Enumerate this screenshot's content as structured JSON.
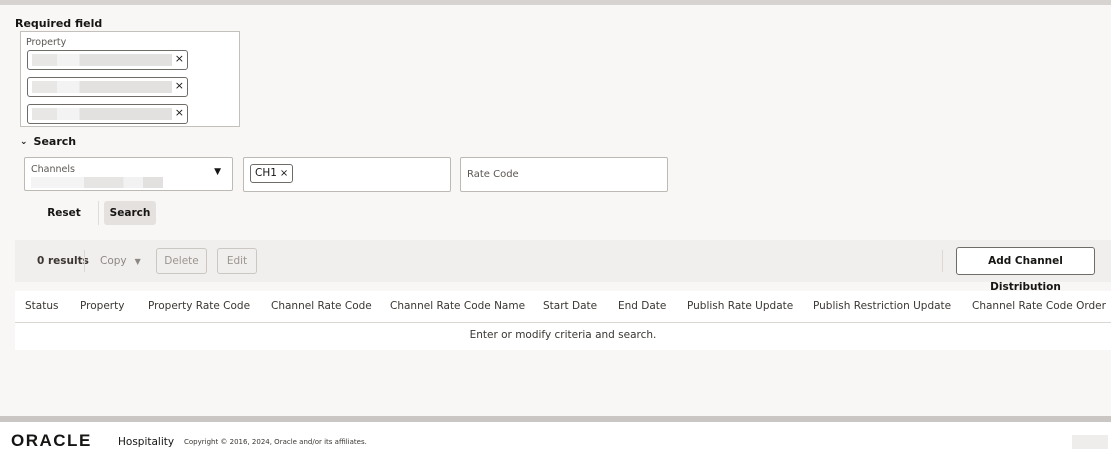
{
  "required_field": {
    "label": "Required field",
    "property_label": "Property",
    "chips": [
      {
        "remove": "×"
      },
      {
        "remove": "×"
      },
      {
        "remove": "×"
      }
    ]
  },
  "search_section": {
    "label": "Search",
    "chevron": "chevron-down-icon"
  },
  "filters": {
    "channels": {
      "label": "Channels",
      "caret": "▼"
    },
    "channel_chip": {
      "value": "CH1",
      "remove": "×"
    },
    "rate_code": {
      "placeholder": "Rate Code"
    }
  },
  "actions": {
    "reset": "Reset",
    "search": "Search"
  },
  "toolbar": {
    "results": "0 results",
    "copy": "Copy",
    "copy_caret": "▼",
    "delete": "Delete",
    "edit": "Edit",
    "add": "Add Channel Distribution"
  },
  "table": {
    "columns": [
      "Status",
      "Property",
      "Property Rate Code",
      "Channel Rate Code",
      "Channel Rate Code Name",
      "Start Date",
      "End Date",
      "Publish Rate Update",
      "Publish Restriction Update",
      "Channel Rate Code Order"
    ],
    "empty_message": "Enter or modify criteria and search."
  },
  "footer": {
    "brand": "ORACLE",
    "product": "Hospitality",
    "copyright": "Copyright © 2016, 2024, Oracle and/or its affiliates."
  }
}
